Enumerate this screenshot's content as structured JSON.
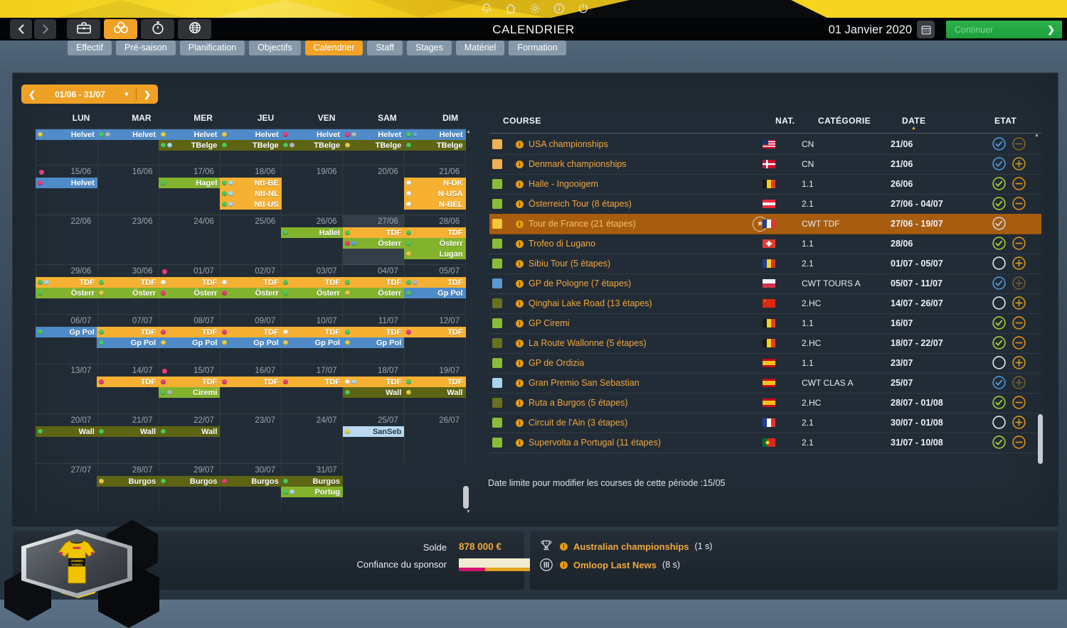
{
  "topbar": {
    "title": "CALENDRIER",
    "date": "01 Janvier 2020",
    "continue_label": "Continuer",
    "system_icons": [
      "bell",
      "home",
      "gear",
      "info",
      "power"
    ],
    "module_buttons": [
      {
        "icon": "briefcase",
        "active": false
      },
      {
        "icon": "rings",
        "active": true
      },
      {
        "icon": "stopwatch",
        "active": false
      },
      {
        "icon": "globe",
        "active": false
      }
    ]
  },
  "tabs": [
    {
      "label": "Effectif",
      "active": false
    },
    {
      "label": "Pré-saison",
      "active": false
    },
    {
      "label": "Planification",
      "active": false
    },
    {
      "label": "Objectifs",
      "active": false
    },
    {
      "label": "Calendrier",
      "active": true
    },
    {
      "label": "Staff",
      "active": false
    },
    {
      "label": "Stages",
      "active": false
    },
    {
      "label": "Matériel",
      "active": false
    },
    {
      "label": "Formation",
      "active": false
    }
  ],
  "calendar": {
    "range": "01/06 - 31/07",
    "day_headers": [
      "LUN",
      "MAR",
      "MER",
      "JEU",
      "VEN",
      "SAM",
      "DIM"
    ],
    "weeks": [
      {
        "h": 51,
        "dates": null,
        "lines": [
          [
            {
              "col": 0,
              "c": "blue",
              "t": "Helvet",
              "d": [
                "y"
              ]
            },
            {
              "col": 1,
              "c": "blue",
              "t": "Helvet",
              "d": [
                "g",
                "gy"
              ]
            },
            {
              "col": 2,
              "c": "blue",
              "t": "Helvet",
              "d": [
                "y"
              ]
            },
            {
              "col": 3,
              "c": "blue",
              "t": "Helvet",
              "d": [
                "y"
              ]
            },
            {
              "col": 4,
              "c": "blue",
              "t": "Helvet",
              "d": [
                "p"
              ]
            },
            {
              "col": 5,
              "c": "blue",
              "t": "Helvet",
              "d": [
                "p",
                "gy"
              ]
            },
            {
              "col": 6,
              "c": "blue",
              "t": "Helvet",
              "d": [
                "g",
                "b"
              ]
            }
          ],
          [
            {
              "col": 2,
              "c": "olive",
              "t": "TBelge",
              "d": [
                "g",
                "lb"
              ]
            },
            {
              "col": 3,
              "c": "olive",
              "t": "TBelge",
              "d": [
                "g"
              ]
            },
            {
              "col": 4,
              "c": "olive",
              "t": "TBelge",
              "d": [
                "g",
                "gy"
              ]
            },
            {
              "col": 5,
              "c": "olive",
              "t": "TBelge",
              "d": [
                "y"
              ]
            },
            {
              "col": 6,
              "c": "olive",
              "t": "TBelge",
              "d": [
                "g"
              ]
            }
          ]
        ]
      },
      {
        "dates": [
          "15/06",
          "16/06",
          "17/06",
          "18/06",
          "19/06",
          "20/06",
          "21/06"
        ],
        "date_dot_col": 0,
        "lines": [
          [
            {
              "col": 0,
              "c": "blue",
              "t": "Helvet",
              "d": [
                "p"
              ]
            },
            {
              "col": 2,
              "c": "green",
              "t": "Hagel",
              "d": [
                "g"
              ]
            },
            {
              "col": 3,
              "c": "orange",
              "t": "Ntt-BE",
              "d": [
                "g",
                "lb"
              ]
            },
            {
              "col": 6,
              "c": "orange",
              "t": "N-DK",
              "d": [
                "w"
              ]
            }
          ],
          [
            {
              "col": 3,
              "c": "orange",
              "t": "Ntt-NL",
              "d": [
                "g",
                "lb"
              ]
            },
            {
              "col": 6,
              "c": "orange",
              "t": "N-USA",
              "d": [
                "w"
              ]
            }
          ],
          [
            {
              "col": 3,
              "c": "orange",
              "t": "Ntt-US",
              "d": [
                "g",
                "lb"
              ]
            },
            {
              "col": 6,
              "c": "orange",
              "t": "N-BEL",
              "d": [
                "w"
              ]
            }
          ]
        ]
      },
      {
        "dates": [
          "22/06",
          "23/06",
          "24/06",
          "25/06",
          "26/06",
          "27/06",
          "28/06"
        ],
        "highlight_col": 5,
        "lines": [
          [
            {
              "col": 4,
              "c": "green",
              "t": "HalleI",
              "d": [
                "g"
              ]
            },
            {
              "col": 5,
              "c": "orange",
              "t": "TDF",
              "d": [
                "g"
              ]
            },
            {
              "col": 6,
              "c": "orange",
              "t": "TDF",
              "d": [
                "g"
              ]
            }
          ],
          [
            {
              "col": 5,
              "c": "green",
              "t": "Österr",
              "d": [
                "p",
                "b"
              ]
            },
            {
              "col": 6,
              "c": "green",
              "t": "Österr",
              "d": [
                "g"
              ]
            }
          ],
          [
            {
              "col": 6,
              "c": "green",
              "t": "Lugan",
              "d": [
                "y"
              ]
            }
          ]
        ]
      },
      {
        "dates": [
          "29/06",
          "30/06",
          "01/07",
          "02/07",
          "03/07",
          "04/07",
          "05/07"
        ],
        "date_dot_col": 2,
        "lines": [
          [
            {
              "col": 0,
              "c": "orange",
              "t": "TDF",
              "d": [
                "g",
                "lb"
              ]
            },
            {
              "col": 1,
              "c": "orange",
              "t": "TDF",
              "d": [
                "g"
              ]
            },
            {
              "col": 2,
              "c": "orange",
              "t": "TDF",
              "d": [
                "w"
              ]
            },
            {
              "col": 3,
              "c": "orange",
              "t": "TDF",
              "d": [
                "w"
              ]
            },
            {
              "col": 4,
              "c": "orange",
              "t": "TDF",
              "d": [
                "g"
              ]
            },
            {
              "col": 5,
              "c": "orange",
              "t": "TDF",
              "d": [
                "g"
              ]
            },
            {
              "col": 6,
              "c": "orange",
              "t": "TDF",
              "d": [
                "g",
                "gy"
              ]
            }
          ],
          [
            {
              "col": 0,
              "c": "green",
              "t": "Österr",
              "d": [
                "g"
              ]
            },
            {
              "col": 1,
              "c": "green",
              "t": "Österr",
              "d": [
                "y"
              ]
            },
            {
              "col": 2,
              "c": "green",
              "t": "Österr",
              "d": [
                "p"
              ]
            },
            {
              "col": 3,
              "c": "green",
              "t": "Österr",
              "d": [
                "p"
              ]
            },
            {
              "col": 4,
              "c": "green",
              "t": "Österr",
              "d": [
                "g"
              ]
            },
            {
              "col": 5,
              "c": "green",
              "t": "Österr",
              "d": [
                "y"
              ]
            },
            {
              "col": 6,
              "c": "blue",
              "t": "Gp Pol",
              "d": [
                "g"
              ]
            }
          ]
        ]
      },
      {
        "dates": [
          "06/07",
          "07/07",
          "08/07",
          "09/07",
          "10/07",
          "11/07",
          "12/07"
        ],
        "lines": [
          [
            {
              "col": 0,
              "c": "blue",
              "t": "Gp Pol",
              "d": [
                "g"
              ]
            },
            {
              "col": 1,
              "c": "orange",
              "t": "TDF",
              "d": [
                "g"
              ]
            },
            {
              "col": 2,
              "c": "orange",
              "t": "TDF",
              "d": [
                "p"
              ]
            },
            {
              "col": 3,
              "c": "orange",
              "t": "TDF",
              "d": [
                "p"
              ]
            },
            {
              "col": 4,
              "c": "orange",
              "t": "TDF",
              "d": [
                "w"
              ]
            },
            {
              "col": 5,
              "c": "orange",
              "t": "TDF",
              "d": [
                "g"
              ]
            },
            {
              "col": 6,
              "c": "orange",
              "t": "TDF",
              "d": [
                "p"
              ]
            }
          ],
          [
            {
              "col": 1,
              "c": "blue",
              "t": "Gp Pol",
              "d": [
                "g"
              ]
            },
            {
              "col": 2,
              "c": "blue",
              "t": "Gp Pol",
              "d": [
                "y"
              ]
            },
            {
              "col": 3,
              "c": "blue",
              "t": "Gp Pol",
              "d": [
                "y"
              ]
            },
            {
              "col": 4,
              "c": "blue",
              "t": "Gp Pol",
              "d": [
                "y"
              ]
            },
            {
              "col": 5,
              "c": "blue",
              "t": "Gp Pol",
              "d": [
                "y"
              ]
            }
          ]
        ]
      },
      {
        "dates": [
          "13/07",
          "14/07",
          "15/07",
          "16/07",
          "17/07",
          "18/07",
          "19/07"
        ],
        "date_dot_col": 2,
        "lines": [
          [
            {
              "col": 1,
              "c": "orange",
              "t": "TDF",
              "d": [
                "p"
              ]
            },
            {
              "col": 2,
              "c": "orange",
              "t": "TDF",
              "d": [
                "p"
              ]
            },
            {
              "col": 3,
              "c": "orange",
              "t": "TDF",
              "d": [
                "p"
              ]
            },
            {
              "col": 4,
              "c": "orange",
              "t": "TDF",
              "d": [
                "p"
              ]
            },
            {
              "col": 5,
              "c": "orange",
              "t": "TDF",
              "d": [
                "w",
                "lb"
              ]
            },
            {
              "col": 6,
              "c": "orange",
              "t": "TDF",
              "d": [
                "g"
              ]
            }
          ],
          [
            {
              "col": 2,
              "c": "green",
              "t": "Ciremi",
              "d": [
                "g",
                "gy"
              ]
            },
            {
              "col": 5,
              "c": "olive",
              "t": "Wall",
              "d": [
                "g"
              ]
            },
            {
              "col": 6,
              "c": "olive",
              "t": "Wall",
              "d": [
                "y"
              ]
            }
          ]
        ]
      },
      {
        "dates": [
          "20/07",
          "21/07",
          "22/07",
          "23/07",
          "24/07",
          "25/07",
          "26/07"
        ],
        "lines": [
          [
            {
              "col": 0,
              "c": "olive",
              "t": "Wall",
              "d": [
                "g"
              ]
            },
            {
              "col": 1,
              "c": "olive",
              "t": "Wall",
              "d": [
                "g"
              ]
            },
            {
              "col": 2,
              "c": "olive",
              "t": "Wall",
              "d": [
                "g"
              ]
            },
            {
              "col": 5,
              "c": "lightblue",
              "t": "SanSeb",
              "d": [
                "y"
              ],
              "dark": true
            }
          ]
        ]
      },
      {
        "dates": [
          "27/07",
          "28/07",
          "29/07",
          "30/07",
          "31/07"
        ],
        "ncols": 5,
        "lines": [
          [
            {
              "col": 1,
              "c": "olive",
              "t": "Burgos",
              "d": [
                "y"
              ]
            },
            {
              "col": 2,
              "c": "olive",
              "t": "Burgos",
              "d": [
                "g"
              ]
            },
            {
              "col": 3,
              "c": "olive",
              "t": "Burgos",
              "d": [
                "p"
              ]
            },
            {
              "col": 4,
              "c": "olive",
              "t": "Burgos",
              "d": [
                "g"
              ]
            }
          ],
          [
            {
              "col": 4,
              "c": "green",
              "t": "Portug",
              "d": [
                "g",
                "lb"
              ]
            }
          ]
        ]
      }
    ]
  },
  "table": {
    "headers": {
      "course": "COURSE",
      "nat": "NAT.",
      "cat": "CATÉGORIE",
      "date": "DATE",
      "etat": "ETAT"
    },
    "rows": [
      {
        "sq": "orange",
        "name": "USA championships",
        "flag": "us",
        "cat": "CN",
        "date": "21/06",
        "check": "blue",
        "act": "minus_dim"
      },
      {
        "sq": "orange",
        "name": "Denmark championships",
        "flag": "dk",
        "cat": "CN",
        "date": "21/06",
        "check": "blue",
        "act": "plus_gold"
      },
      {
        "sq": "green",
        "name": "Halle - Ingooigem",
        "flag": "be",
        "cat": "1.1",
        "date": "26/06",
        "check": "green",
        "act": "minus"
      },
      {
        "sq": "green",
        "name": "Österreich Tour (8 étapes)",
        "flag": "at",
        "cat": "2.1",
        "date": "27/06 - 04/07",
        "check": "green",
        "act": "minus"
      },
      {
        "sq": "yellow",
        "name": "Tour de France (21 étapes)",
        "star": true,
        "flag": "fr",
        "cat": "CWT TDF",
        "date": "27/06 - 19/07",
        "check": "grey",
        "act": "none",
        "hl": true
      },
      {
        "sq": "green",
        "name": "Trofeo di Lugano",
        "flag": "ch",
        "cat": "1.1",
        "date": "28/06",
        "check": "green",
        "act": "minus"
      },
      {
        "sq": "green",
        "name": "Sibiu Tour (5 étapes)",
        "flag": "ro",
        "cat": "2.1",
        "date": "01/07 - 05/07",
        "check": "empty",
        "act": "plus"
      },
      {
        "sq": "blue",
        "name": "GP de Pologne (7 étapes)",
        "flag": "pl",
        "cat": "CWT TOURS A",
        "date": "05/07 - 11/07",
        "check": "blue",
        "act": "plus_dim"
      },
      {
        "sq": "olive",
        "name": "Qinghai Lake Road (13 étapes)",
        "flag": "cn",
        "cat": "2.HC",
        "date": "14/07 - 26/07",
        "check": "empty",
        "act": "plus"
      },
      {
        "sq": "green",
        "name": "GP Ciremi",
        "flag": "be",
        "cat": "1.1",
        "date": "16/07",
        "check": "green",
        "act": "minus"
      },
      {
        "sq": "olive",
        "name": "La Route Wallonne (5 étapes)",
        "flag": "be",
        "cat": "2.HC",
        "date": "18/07 - 22/07",
        "check": "green",
        "act": "minus"
      },
      {
        "sq": "green",
        "name": "GP de Ordizia",
        "flag": "es",
        "cat": "1.1",
        "date": "23/07",
        "check": "empty",
        "act": "plus"
      },
      {
        "sq": "lightblue",
        "name": "Gran Premio San Sebastian",
        "flag": "es",
        "cat": "CWT CLAS A",
        "date": "25/07",
        "check": "blue",
        "act": "plus_dim"
      },
      {
        "sq": "olive",
        "name": "Ruta a Burgos (5 étapes)",
        "flag": "es",
        "cat": "2.HC",
        "date": "28/07 - 01/08",
        "check": "green",
        "act": "minus"
      },
      {
        "sq": "green",
        "name": "Circuit de l'Ain (3 étapes)",
        "flag": "fr",
        "cat": "2.1",
        "date": "30/07 - 01/08",
        "check": "empty",
        "act": "plus"
      },
      {
        "sq": "green",
        "name": "Supervolta a Portugal (11 étapes)",
        "flag": "pt",
        "cat": "2.1",
        "date": "31/07 - 10/08",
        "check": "green",
        "act": "minus"
      }
    ],
    "footnote": "Date limite pour modifier les courses de cette période :15/05"
  },
  "sponsor": {
    "balance_label": "Solde",
    "balance_value": "878 000 €",
    "confidence_label": "Confiance du sponsor",
    "confidence_pct": 72,
    "strip": [
      {
        "color": "#d4116e",
        "pct": 11
      },
      {
        "color": "#e3a41d",
        "pct": 55
      },
      {
        "color": "#16c25c",
        "pct": 17
      }
    ]
  },
  "news": [
    {
      "icon": "trophy",
      "label": "Australian championships",
      "suffix": "(1 s)"
    },
    {
      "icon": "finish",
      "label": "Omloop Last News",
      "suffix": "(8 s)"
    }
  ],
  "palette": {
    "event": {
      "orange": "#f6b133",
      "green": "#83b22d",
      "olive": "#5d6414",
      "blue": "#4f8bc9",
      "lightblue": "#b9d9f2"
    },
    "dot": {
      "y": "#e9cb4a",
      "g": "#4ec95c",
      "p": "#e83d78",
      "w": "#f5f5ea",
      "gy": "#b2b8be",
      "lb": "#a8d8f0",
      "b": "#5fa8dc"
    },
    "swatch": {
      "orange": "#f0b054",
      "yellow": "#f5c636",
      "green": "#8abd37",
      "olive": "#67711f",
      "blue": "#589ad2",
      "lightblue": "#a9d3ee"
    }
  }
}
